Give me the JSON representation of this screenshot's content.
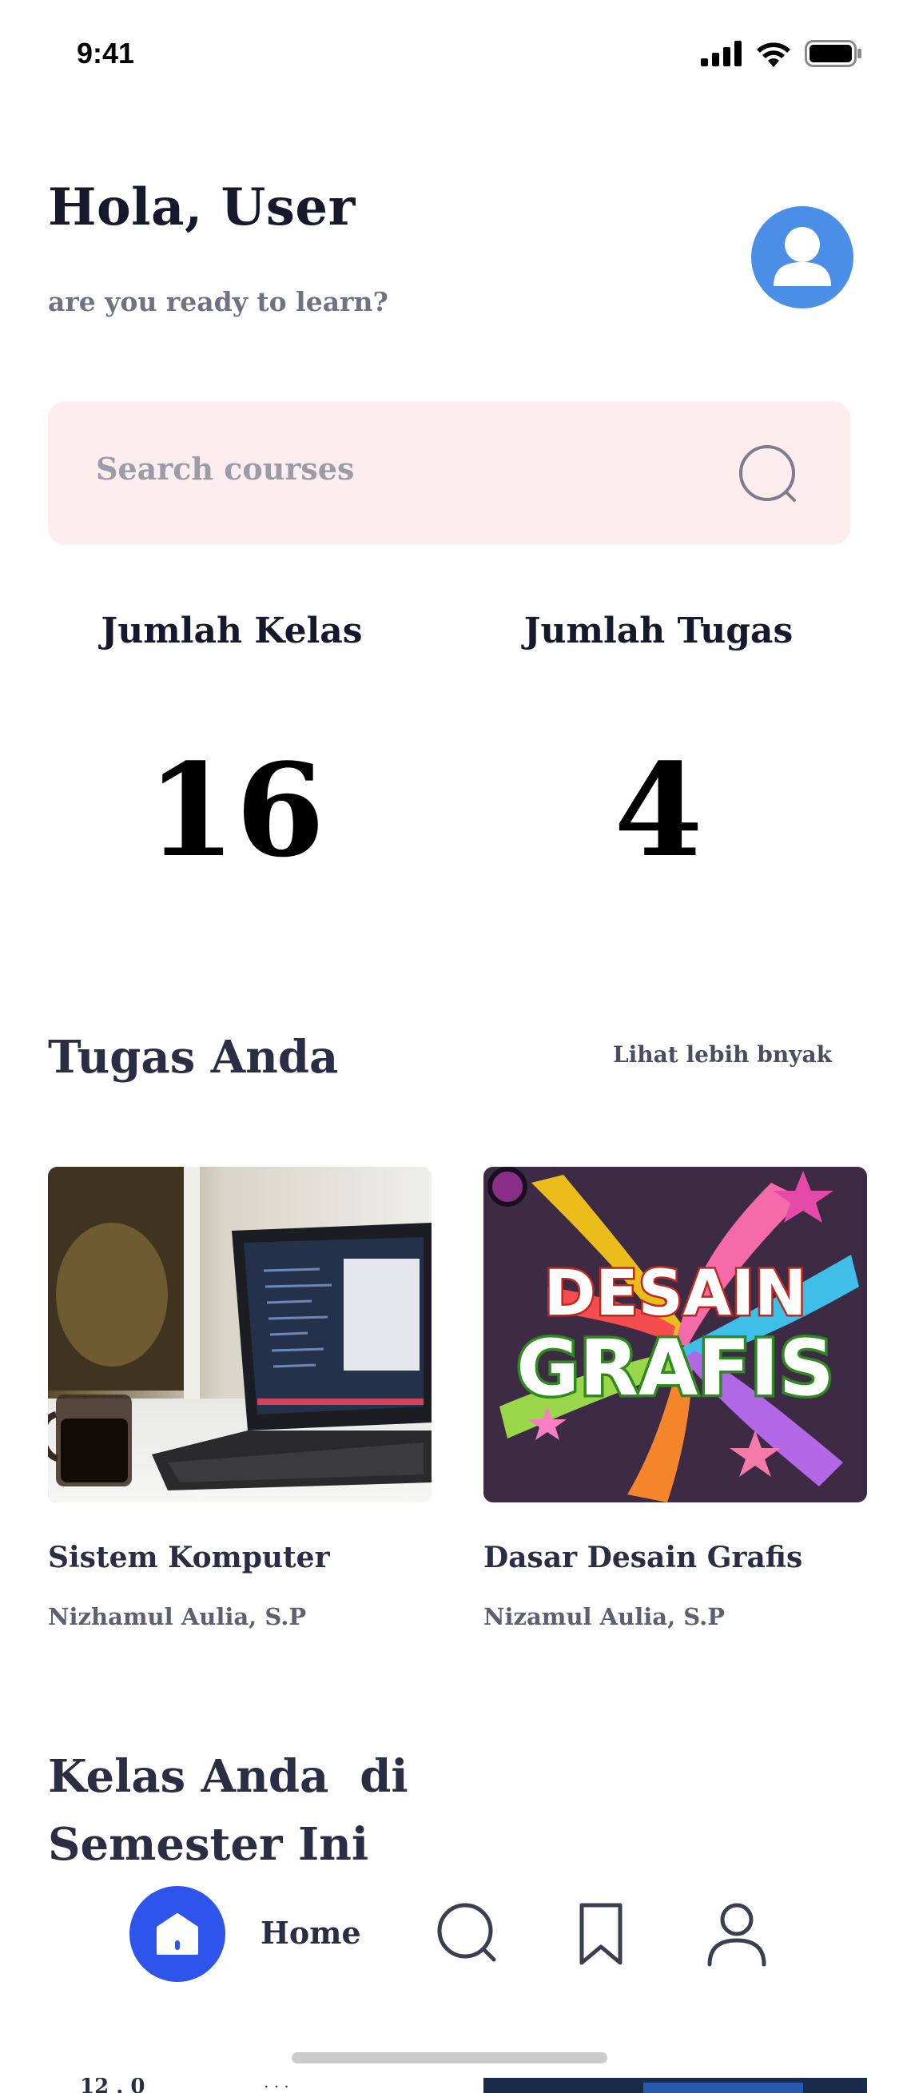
{
  "status_bar": {
    "time": "9:41"
  },
  "header": {
    "greeting": "Hola, User",
    "subtitle": "are you ready to learn?",
    "avatar_icon": "user-avatar-icon"
  },
  "search": {
    "placeholder": "Search courses",
    "icon": "search-icon"
  },
  "stats": [
    {
      "label": "Jumlah Kelas",
      "value": "16"
    },
    {
      "label": "Jumlah Tugas",
      "value": "4"
    }
  ],
  "tasks": {
    "title": "Tugas Anda",
    "see_more": "Lihat lebih bnyak",
    "cards": [
      {
        "title": "Sistem Komputer",
        "author": "Nizhamul Aulia, S.P",
        "image": "laptop-photo"
      },
      {
        "title": "Dasar Desain Grafis",
        "author": "Nizamul Aulia, S.P",
        "image": "desain-grafis-art",
        "image_text_1": "DESAIN",
        "image_text_2": "GRAFIS"
      }
    ]
  },
  "classes": {
    "title_line1": "Kelas Anda  di",
    "title_line2": "Semester Ini"
  },
  "bottom_nav": {
    "items": [
      {
        "label": "Home",
        "icon": "home-icon",
        "active": true
      },
      {
        "label": "",
        "icon": "search-icon",
        "active": false
      },
      {
        "label": "",
        "icon": "bookmark-icon",
        "active": false
      },
      {
        "label": "",
        "icon": "profile-icon",
        "active": false
      }
    ]
  },
  "colors": {
    "accent": "#2f54eb",
    "avatar": "#4b8ee8",
    "search_bg": "#fdedef",
    "text_dark": "#16192c",
    "text_muted": "#6e7282"
  }
}
